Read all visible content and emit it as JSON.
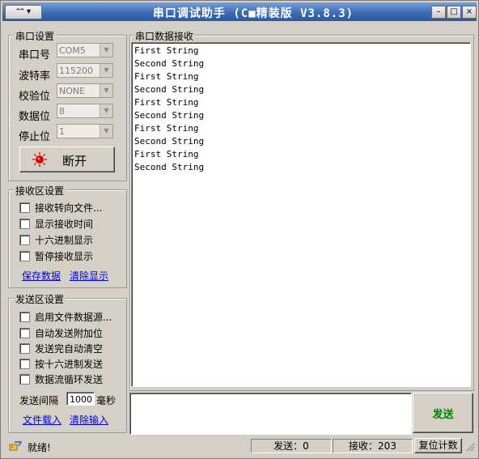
{
  "titlebar": {
    "menu_symbol": "▾",
    "title": "串口调试助手 (C■精装版 V3.8.3)",
    "min": "–",
    "max": "□",
    "close": "×"
  },
  "serial": {
    "group_title": "串口设置",
    "port_label": "串口号",
    "port_value": "COM5",
    "baud_label": "波特率",
    "baud_value": "115200",
    "parity_label": "校验位",
    "parity_value": "NONE",
    "databits_label": "数据位",
    "databits_value": "8",
    "stopbits_label": "停止位",
    "stopbits_value": "1",
    "disconnect_label": "断开"
  },
  "receive": {
    "group_title": "接收区设置",
    "options": [
      "接收转向文件...",
      "显示接收时间",
      "十六进制显示",
      "暂停接收显示"
    ],
    "save_link": "保存数据",
    "clear_link": "清除显示"
  },
  "send": {
    "group_title": "发送区设置",
    "options": [
      "启用文件数据源...",
      "自动发送附加位",
      "发送完自动清空",
      "按十六进制发送",
      "数据流循环发送"
    ],
    "interval_label": "发送间隔",
    "interval_value": "1000",
    "interval_unit": "毫秒",
    "load_link": "文件载入",
    "clear_link": "清除输入",
    "send_button": "发送"
  },
  "recv_panel": {
    "title": "串口数据接收",
    "lines": [
      "First String",
      "Second String",
      "First String",
      "Second String",
      "First String",
      "Second String",
      "First String",
      "Second String",
      "First String",
      "Second String"
    ]
  },
  "status": {
    "ready": "就绪!",
    "sent": "发送：0",
    "received": "接收：203",
    "reset_count": "复位计数"
  }
}
